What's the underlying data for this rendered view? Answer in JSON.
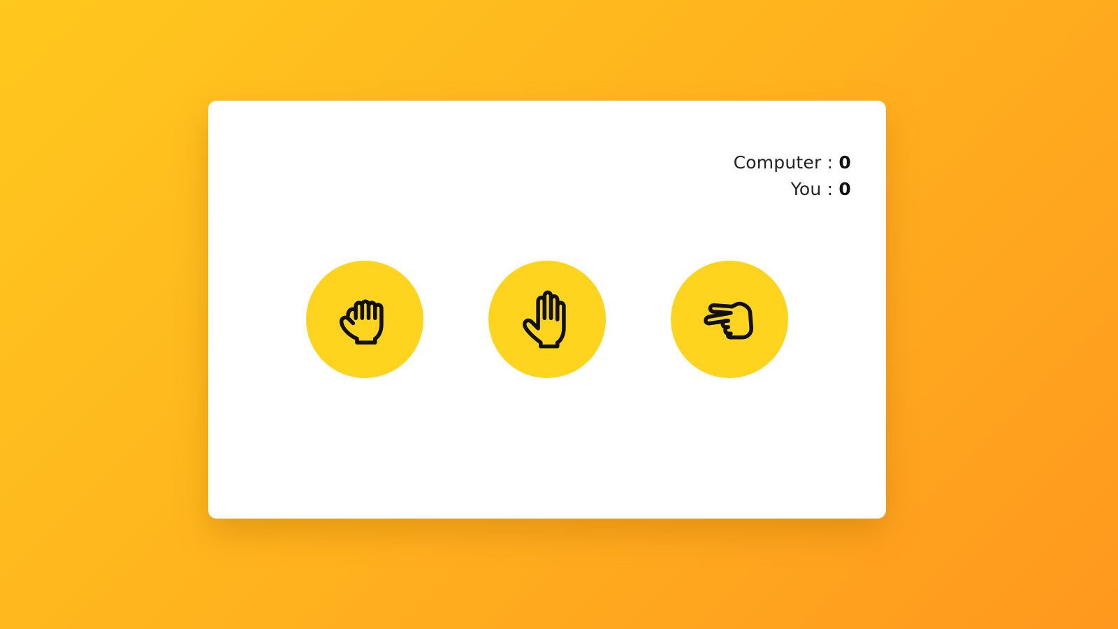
{
  "colors": {
    "background_start": "#ffc81e",
    "background_end": "#ff981e",
    "card": "#ffffff",
    "choice_circle": "#ffd41f",
    "icon_stroke": "#111111"
  },
  "scoreboard": {
    "computer_label": "Computer :",
    "computer_score": "0",
    "you_label": "You :",
    "you_score": "0"
  },
  "choices": [
    {
      "name": "rock",
      "icon": "fist-icon"
    },
    {
      "name": "paper",
      "icon": "open-hand-icon"
    },
    {
      "name": "scissors",
      "icon": "peace-hand-icon"
    }
  ]
}
